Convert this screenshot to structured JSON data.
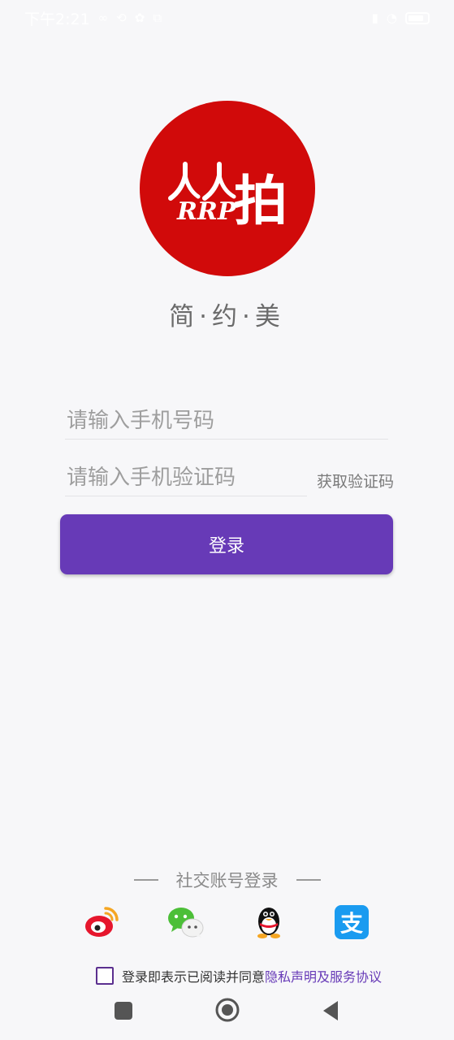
{
  "status_bar": {
    "time": "下午2:21",
    "left_icons": [
      "link-icon",
      "sync-icon",
      "settings-icon",
      "cast-icon",
      "dot"
    ],
    "right_icons": [
      "signal-icon",
      "wifi-icon",
      "battery-icon"
    ]
  },
  "logo": {
    "brand_cn": "人人拍",
    "brand_mark": "RRP",
    "circle_color": "#d10a0a"
  },
  "slogan": "简·约·美",
  "form": {
    "phone_placeholder": "请输入手机号码",
    "code_placeholder": "请输入手机验证码",
    "get_code_label": "获取验证码",
    "login_label": "登录"
  },
  "social": {
    "title": "社交账号登录",
    "providers": [
      "weibo-icon",
      "wechat-icon",
      "qq-icon",
      "alipay-icon"
    ]
  },
  "agreement": {
    "text": "登录即表示已阅读并同意",
    "privacy_link": "隐私声明",
    "and": "及",
    "service_link": "服务协议",
    "checked": false
  },
  "colors": {
    "accent": "#673ab7",
    "logo_red": "#d10a0a",
    "background": "#f7f7f9"
  },
  "nav": [
    "recent-apps-icon",
    "home-icon",
    "back-icon"
  ]
}
